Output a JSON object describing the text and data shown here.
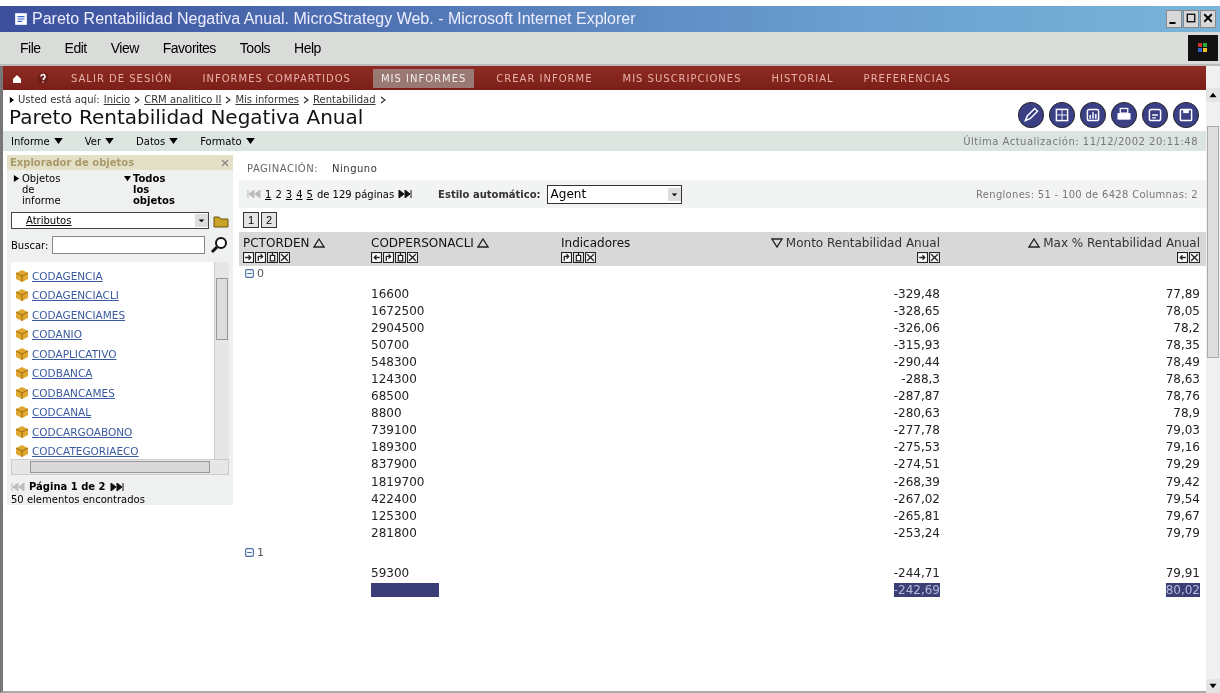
{
  "window": {
    "title": "Pareto Rentabilidad Negativa Anual. MicroStrategy Web. - Microsoft Internet Explorer"
  },
  "menu": [
    "File",
    "Edit",
    "View",
    "Favorites",
    "Tools",
    "Help"
  ],
  "nav": [
    {
      "label": "SALIR DE SESIÓN",
      "selected": false
    },
    {
      "label": "INFORMES COMPARTIDOS",
      "selected": false
    },
    {
      "label": "MIS INFORMES",
      "selected": true
    },
    {
      "label": "CREAR INFORME",
      "selected": false
    },
    {
      "label": "MIS SUSCRIPCIONES",
      "selected": false
    },
    {
      "label": "HISTORIAL",
      "selected": false
    },
    {
      "label": "PREFERENCIAS",
      "selected": false
    }
  ],
  "breadcrumb": {
    "label": "Usted está aquí:",
    "links": [
      "Inicio",
      "CRM analitico II",
      "Mis informes",
      "Rentabilidad"
    ]
  },
  "report_title": "Pareto Rentabilidad Negativa Anual",
  "report_menu": [
    "Informe",
    "Ver",
    "Datos",
    "Formato"
  ],
  "last_update": "Última Actualización: 11/12/2002 20:11:48",
  "explorer": {
    "title": "Explorador de objetos",
    "tabs": [
      {
        "label": "Objetos de informe",
        "selected": false
      },
      {
        "label": "Todos los objetos",
        "selected": true
      }
    ],
    "dropdown": "Atributos",
    "search_label": "Buscar:",
    "items": [
      "CODAGENCIA",
      "CODAGENCIACLI",
      "CODAGENCIAMES",
      "CODANIO",
      "CODAPLICATIVO",
      "CODBANCA",
      "CODBANCAMES",
      "CODCANAL",
      "CODCARGOABONO",
      "CODCATEGORIAECO"
    ],
    "pager": "Página 1 de 2",
    "count": "50 elementos encontrados"
  },
  "paging": {
    "label": "PAGINACIÓN:",
    "value": "Ninguno"
  },
  "pages": [
    {
      "label": "1",
      "selected": false
    },
    {
      "label": "2",
      "selected": true
    },
    {
      "label": "3",
      "selected": false
    },
    {
      "label": "4",
      "selected": false
    },
    {
      "label": "5",
      "selected": false
    }
  ],
  "pages_total": "de 129 páginas",
  "style": {
    "label": "Estilo automático:",
    "value": "Agent"
  },
  "rows_info": "Renglones: 51 - 100 de 6428  Columnas: 2",
  "column_pages": [
    "1",
    "2"
  ],
  "columns": [
    {
      "label": "PCTORDEN",
      "kind": "attribute",
      "sorted": true,
      "descending": false
    },
    {
      "label": "CODPERSONACLI",
      "kind": "attribute",
      "sorted": true,
      "descending": false
    },
    {
      "label": "Indicadores",
      "kind": "attribute",
      "sorted": false
    },
    {
      "label": "Monto Rentabilidad Anual",
      "kind": "metric",
      "sorted": true,
      "descending": true
    },
    {
      "label": "Max % Rentabilidad Anual",
      "kind": "metric",
      "sorted": true,
      "descending": false
    }
  ],
  "groups": [
    {
      "label": "0",
      "expanded": true,
      "rows": [
        {
          "code": "16600",
          "monto": "-329,48",
          "max": "77,89",
          "selected": false
        },
        {
          "code": "1672500",
          "monto": "-328,65",
          "max": "78,05",
          "selected": false
        },
        {
          "code": "2904500",
          "monto": "-326,06",
          "max": "78,2",
          "selected": false
        },
        {
          "code": "50700",
          "monto": "-315,93",
          "max": "78,35",
          "selected": false
        },
        {
          "code": "548300",
          "monto": "-290,44",
          "max": "78,49",
          "selected": false
        },
        {
          "code": "124300",
          "monto": "-288,3",
          "max": "78,63",
          "selected": false
        },
        {
          "code": "68500",
          "monto": "-287,87",
          "max": "78,76",
          "selected": false
        },
        {
          "code": "8800",
          "monto": "-280,63",
          "max": "78,9",
          "selected": false
        },
        {
          "code": "739100",
          "monto": "-277,78",
          "max": "79,03",
          "selected": false
        },
        {
          "code": "189300",
          "monto": "-275,53",
          "max": "79,16",
          "selected": false
        },
        {
          "code": "837900",
          "monto": "-274,51",
          "max": "79,29",
          "selected": false
        },
        {
          "code": "1819700",
          "monto": "-268,39",
          "max": "79,42",
          "selected": false
        },
        {
          "code": "422400",
          "monto": "-267,02",
          "max": "79,54",
          "selected": false
        },
        {
          "code": "125300",
          "monto": "-265,81",
          "max": "79,67",
          "selected": false
        },
        {
          "code": "281800",
          "monto": "-253,24",
          "max": "79,79",
          "selected": false
        }
      ]
    },
    {
      "label": "1",
      "expanded": true,
      "rows": [
        {
          "code": "59300",
          "monto": "-244,71",
          "max": "79,91",
          "selected": false
        },
        {
          "monto": "-242,69",
          "max": "80,02",
          "selected": true
        }
      ]
    }
  ]
}
